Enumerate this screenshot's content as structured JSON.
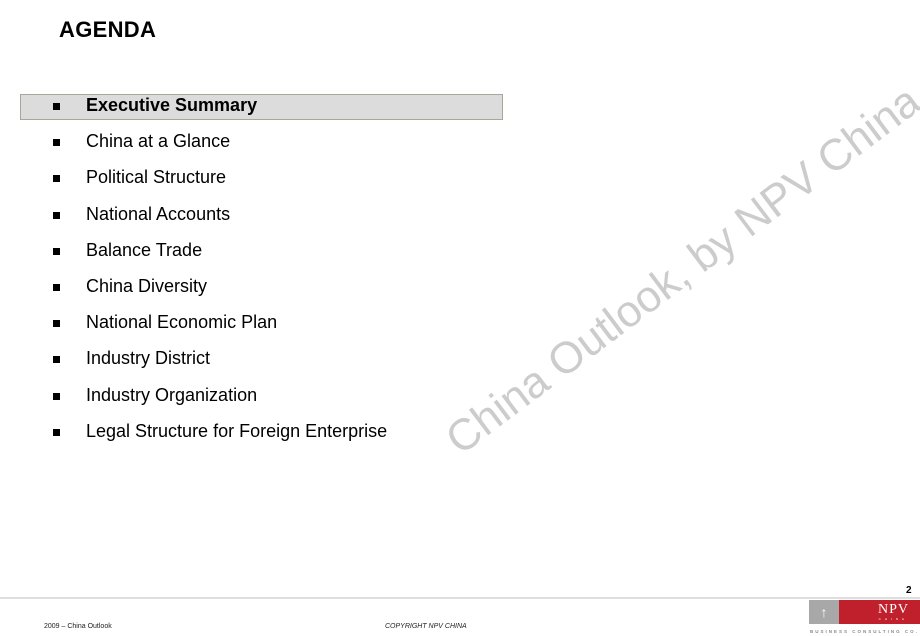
{
  "slide": {
    "title": "AGENDA",
    "page_number": "2"
  },
  "agenda": {
    "items": [
      {
        "label": "Executive Summary",
        "active": true
      },
      {
        "label": "China at a Glance",
        "active": false
      },
      {
        "label": "Political Structure",
        "active": false
      },
      {
        "label": "National Accounts",
        "active": false
      },
      {
        "label": "Balance Trade",
        "active": false
      },
      {
        "label": "China Diversity",
        "active": false
      },
      {
        "label": "National Economic Plan",
        "active": false
      },
      {
        "label": "Industry District",
        "active": false
      },
      {
        "label": "Industry Organization",
        "active": false
      },
      {
        "label": "Legal Structure for Foreign Enterprise",
        "active": false
      }
    ]
  },
  "watermark": "China Outlook, by NPV China",
  "footer": {
    "left": "2009 – China Outlook",
    "center": "COPYRIGHT NPV CHINA"
  },
  "logo": {
    "arrow_icon": "arrow-up-icon",
    "brand": "NPV",
    "brand_sub": "CHINA",
    "tagline": "BUSINESS CONSULTING CO.",
    "colors": {
      "brand_red": "#c0202b",
      "arrow_gray": "#a8a8a8"
    }
  },
  "colors": {
    "active_item_bg": "#dcdcdc",
    "active_item_border": "#a9a69c",
    "watermark": "#cccccc"
  }
}
